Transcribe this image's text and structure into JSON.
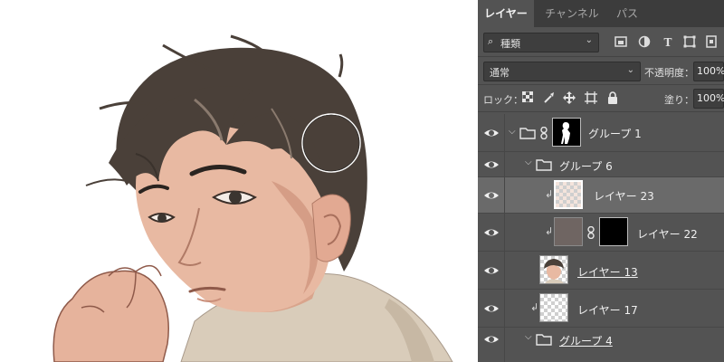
{
  "tabs": [
    {
      "label": "レイヤー",
      "active": true
    },
    {
      "label": "チャンネル",
      "active": false
    },
    {
      "label": "パス",
      "active": false
    }
  ],
  "filter": {
    "kind_label": "種類",
    "icons": [
      "pixel-filter-icon",
      "adjustment-filter-icon",
      "type-filter-icon",
      "shape-filter-icon",
      "smart-object-filter-icon"
    ]
  },
  "blend": {
    "mode": "通常",
    "opacity_label": "不透明度：",
    "opacity_value": "100%"
  },
  "lock": {
    "label": "ロック：",
    "fill_label": "塗り：",
    "fill_value": "100%"
  },
  "layers": [
    {
      "name": "グループ 1",
      "type": "group",
      "expanded": true,
      "has_mask": true,
      "underline": false,
      "selected": false
    },
    {
      "name": "グループ 6",
      "type": "group",
      "expanded": true,
      "has_mask": false,
      "underline": false,
      "selected": false
    },
    {
      "name": "レイヤー 23",
      "type": "layer",
      "clipped": true,
      "underline": false,
      "selected": true
    },
    {
      "name": "レイヤー 22",
      "type": "layer",
      "clipped": true,
      "has_mask": true,
      "underline": false,
      "selected": false
    },
    {
      "name": "レイヤー 13",
      "type": "layer",
      "clipped": false,
      "underline": true,
      "selected": false
    },
    {
      "name": "レイヤー 17",
      "type": "layer",
      "clipped": true,
      "underline": false,
      "selected": false
    },
    {
      "name": "グループ 4",
      "type": "group",
      "expanded": true,
      "underline": true,
      "selected": false
    }
  ],
  "colors": {
    "panel_bg": "#535353",
    "tab_bar_bg": "#3c3c3c",
    "selected_row": "#6a6a6a",
    "hair": "#4a4039",
    "skin": "#e8b9a2",
    "hoodie": "#d9ccba"
  }
}
